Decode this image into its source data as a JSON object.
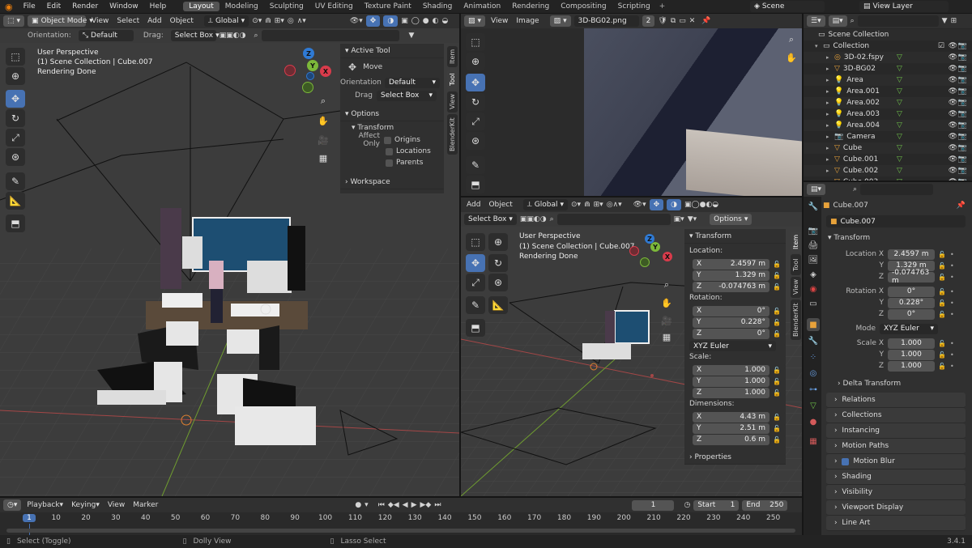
{
  "topbar": {
    "menus": [
      "File",
      "Edit",
      "Render",
      "Window",
      "Help"
    ],
    "workspaces": [
      "Layout",
      "Modeling",
      "Sculpting",
      "UV Editing",
      "Texture Paint",
      "Shading",
      "Animation",
      "Rendering",
      "Compositing",
      "Scripting"
    ],
    "active_workspace": "Layout",
    "scene": "Scene",
    "view_layer": "View Layer"
  },
  "viewport_left": {
    "mode": "Object Mode",
    "menus": [
      "View",
      "Select",
      "Add",
      "Object"
    ],
    "transform_orientation": "Global",
    "orientation_label": "Orientation:",
    "orientation_value": "Default",
    "drag_label": "Drag:",
    "drag_value": "Select Box",
    "overlay_line1": "User Perspective",
    "overlay_line2": "(1) Scene Collection | Cube.007",
    "overlay_line3": "Rendering Done",
    "npanel": {
      "active_tool": "Active Tool",
      "move": "Move",
      "orientation_label": "Orientation",
      "orientation_value": "Default",
      "drag_label": "Drag",
      "drag_value": "Select Box",
      "options": "Options",
      "transform": "Transform",
      "affect_only": "Affect Only",
      "origins": "Origins",
      "locations": "Locations",
      "parents": "Parents",
      "workspace": "Workspace"
    },
    "tabs": [
      "Item",
      "Tool",
      "View",
      "BlenderKit"
    ]
  },
  "image_editor": {
    "menus": [
      "View",
      "Image"
    ],
    "image_name": "3D-BG02.png",
    "users": "2"
  },
  "viewport_right": {
    "menus": [
      "Add",
      "Object"
    ],
    "transform_orientation": "Global",
    "select_mode": "Select Box",
    "options": "Options",
    "overlay_line1": "User Perspective",
    "overlay_line2": "(1) Scene Collection | Cube.007",
    "overlay_line3": "Rendering Done",
    "npanel": {
      "transform": "Transform",
      "location": "Location:",
      "loc": [
        {
          "axis": "X",
          "value": "2.4597 m"
        },
        {
          "axis": "Y",
          "value": "1.329 m"
        },
        {
          "axis": "Z",
          "value": "-0.074763 m"
        }
      ],
      "rotation": "Rotation:",
      "rot": [
        {
          "axis": "X",
          "value": "0°"
        },
        {
          "axis": "Y",
          "value": "0.228°"
        },
        {
          "axis": "Z",
          "value": "0°"
        }
      ],
      "rotation_mode": "XYZ Euler",
      "scale": "Scale:",
      "scl": [
        {
          "axis": "X",
          "value": "1.000"
        },
        {
          "axis": "Y",
          "value": "1.000"
        },
        {
          "axis": "Z",
          "value": "1.000"
        }
      ],
      "dimensions": "Dimensions:",
      "dim": [
        {
          "axis": "X",
          "value": "4.43 m"
        },
        {
          "axis": "Y",
          "value": "2.51 m"
        },
        {
          "axis": "Z",
          "value": "0.6 m"
        }
      ],
      "properties": "Properties"
    },
    "tabs": [
      "Item",
      "Tool",
      "View",
      "BlenderKit"
    ]
  },
  "outliner": {
    "root": "Scene Collection",
    "collection": "Collection",
    "items": [
      "3D-02.fspy",
      "3D-BG02",
      "Area",
      "Area.001",
      "Area.002",
      "Area.003",
      "Area.004",
      "Camera",
      "Cube",
      "Cube.001",
      "Cube.002",
      "Cube.003"
    ]
  },
  "properties": {
    "object_name_header": "Cube.007",
    "object_name": "Cube.007",
    "transform": "Transform",
    "location_x_label": "Location X",
    "y_label": "Y",
    "z_label": "Z",
    "location": [
      "2.4597 m",
      "1.329 m",
      "-0.074763 m"
    ],
    "rotation_x_label": "Rotation X",
    "rotation": [
      "0°",
      "0.228°",
      "0°"
    ],
    "mode_label": "Mode",
    "mode_value": "XYZ Euler",
    "scale_x_label": "Scale X",
    "scale": [
      "1.000",
      "1.000",
      "1.000"
    ],
    "delta_transform": "Delta Transform",
    "sections": [
      "Relations",
      "Collections",
      "Instancing",
      "Motion Paths",
      "Motion Blur",
      "Shading",
      "Visibility",
      "Viewport Display",
      "Line Art"
    ]
  },
  "timeline": {
    "menus": [
      "Playback",
      "Keying",
      "View",
      "Marker"
    ],
    "current_frame": "1",
    "start_label": "Start",
    "start": "1",
    "end_label": "End",
    "end": "250",
    "ticks": [
      "1",
      "10",
      "20",
      "30",
      "40",
      "50",
      "60",
      "70",
      "80",
      "90",
      "100",
      "110",
      "120",
      "130",
      "140",
      "150",
      "160",
      "170",
      "180",
      "190",
      "200",
      "210",
      "220",
      "230",
      "240",
      "250"
    ]
  },
  "statusbar": {
    "select": "Select (Toggle)",
    "dolly": "Dolly View",
    "lasso": "Lasso Select",
    "version": "3.4.1"
  }
}
